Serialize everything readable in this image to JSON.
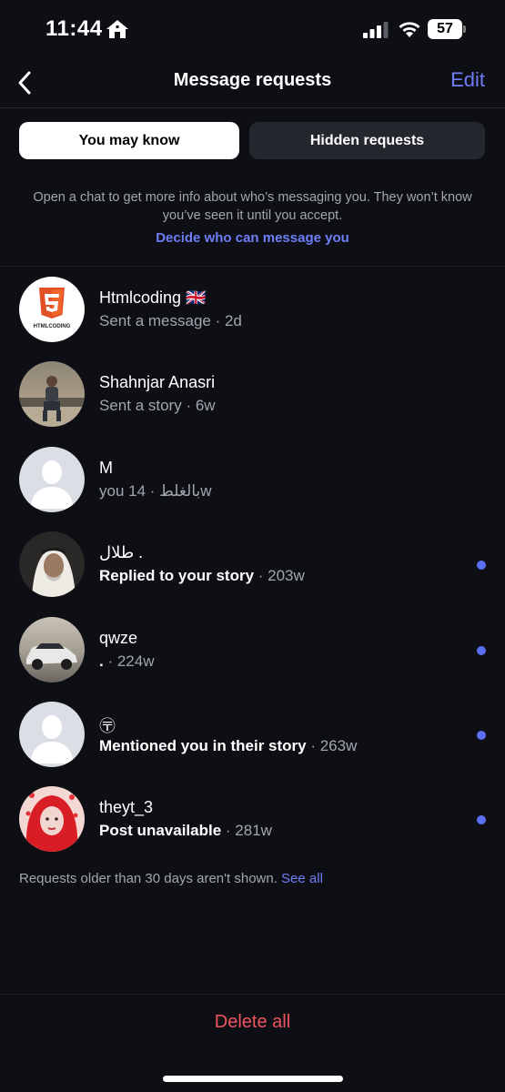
{
  "status_bar": {
    "time": "11:44",
    "battery": "57",
    "icons": [
      "home-icon",
      "signal-icon",
      "wifi-icon",
      "battery-icon"
    ]
  },
  "header": {
    "title": "Message requests",
    "edit_label": "Edit",
    "back_icon": "chevron-left-icon"
  },
  "tabs": [
    {
      "label": "You may know",
      "active": true
    },
    {
      "label": "Hidden requests",
      "active": false
    }
  ],
  "info": {
    "text": "Open a chat to get more info about who’s messaging you. They won’t know you’ve seen it until you accept.",
    "link": "Decide who can message you"
  },
  "requests": [
    {
      "name": "Htmlcoding 🇬🇧",
      "subtitle": "Sent a message",
      "time": " · 2d",
      "unread": false,
      "avatar": "html5-logo"
    },
    {
      "name": "Shahnjar Anasri",
      "subtitle": "Sent a story",
      "time": " · 6w",
      "unread": false,
      "avatar": "photo-person-sitting"
    },
    {
      "name": "M",
      "subtitle": "you بالغلط",
      "time": " · 14w",
      "unread": false,
      "avatar": "default-avatar"
    },
    {
      "name": "طلال .",
      "subtitle": "Replied to your story",
      "time": " · 203w",
      "unread": true,
      "avatar": "photo-man-headscarf"
    },
    {
      "name": "qwze",
      "subtitle": ".",
      "time": " · 224w",
      "unread": true,
      "avatar": "photo-car"
    },
    {
      "name": "〶",
      "subtitle": "Mentioned you in their story",
      "time": " · 263w",
      "unread": true,
      "avatar": "default-avatar"
    },
    {
      "name": "theyt_3",
      "subtitle": "Post unavailable",
      "time": " · 281w",
      "unread": true,
      "avatar": "photo-red-hair"
    }
  ],
  "footer": {
    "note": "Requests older than 30 days aren't shown.",
    "see_all": "See all",
    "delete_all": "Delete all"
  },
  "colors": {
    "background": "#0d0f14",
    "accent": "#6f7ef7",
    "unread_dot": "#5b6ff2",
    "danger": "#ee5560"
  },
  "avatar_badges": {
    "html5_text": "HTMLCODING"
  }
}
